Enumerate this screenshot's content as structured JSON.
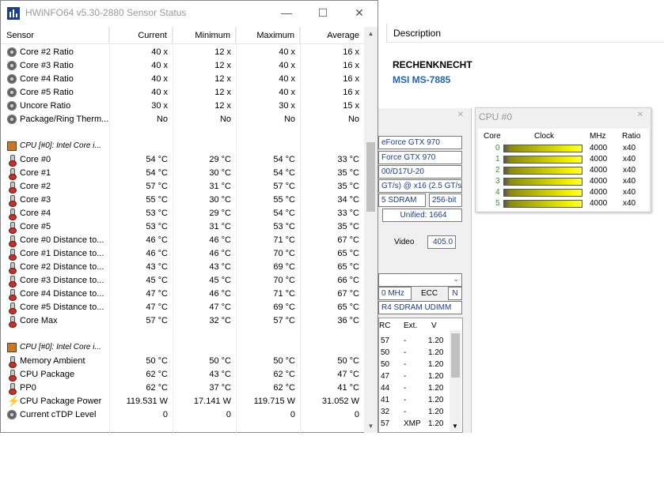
{
  "background_window": {
    "description_header": "Description",
    "machine_name": "RECHENKNECHT",
    "board_name": "MSI MS-7885",
    "summary": {
      "gpu_name_1": "eForce GTX 970",
      "gpu_name_2": "Force GTX 970",
      "gpu_id": "00/D17U-20",
      "gpu_bus": "GT/s) @ x16 (2.5 GT/s)",
      "gpu_mem_type": "5 SDRAM",
      "gpu_mem_width": "256-bit",
      "gpu_unified": "Unified: 1664",
      "video_label": "Video",
      "video_value": "405.0",
      "mem_clock": "0 MHz",
      "ecc_label": "ECC",
      "ecc_value": "N",
      "mem_type": "R4 SDRAM UDIMM",
      "mem_table_headers": [
        "RC",
        "Ext.",
        "V"
      ],
      "mem_table_rows": [
        [
          "57",
          "-",
          "1.20"
        ],
        [
          "50",
          "-",
          "1.20"
        ],
        [
          "50",
          "-",
          "1.20"
        ],
        [
          "47",
          "-",
          "1.20"
        ],
        [
          "44",
          "-",
          "1.20"
        ],
        [
          "41",
          "-",
          "1.20"
        ],
        [
          "32",
          "-",
          "1.20"
        ],
        [
          "57",
          "XMP",
          "1.20"
        ]
      ]
    }
  },
  "cpu_window": {
    "title": "CPU #0",
    "headers": [
      "Core",
      "Clock",
      "MHz",
      "Ratio"
    ],
    "cores": [
      {
        "index": "0",
        "mhz": "4000",
        "ratio": "x40",
        "level": 1.0
      },
      {
        "index": "1",
        "mhz": "4000",
        "ratio": "x40",
        "level": 1.0
      },
      {
        "index": "2",
        "mhz": "4000",
        "ratio": "x40",
        "level": 1.0
      },
      {
        "index": "3",
        "mhz": "4000",
        "ratio": "x40",
        "level": 1.0
      },
      {
        "index": "4",
        "mhz": "4000",
        "ratio": "x40",
        "level": 1.0
      },
      {
        "index": "5",
        "mhz": "4000",
        "ratio": "x40",
        "level": 1.0
      }
    ]
  },
  "sensor_window": {
    "title": "HWiNFO64 v5.30-2880 Sensor Status",
    "columns": [
      "Sensor",
      "Current",
      "Minimum",
      "Maximum",
      "Average"
    ],
    "rows": [
      {
        "icon": "gear-icon",
        "name": "Core #2 Ratio",
        "current": "40 x",
        "minimum": "12 x",
        "maximum": "40 x",
        "average": "16 x"
      },
      {
        "icon": "gear-icon",
        "name": "Core #3 Ratio",
        "current": "40 x",
        "minimum": "12 x",
        "maximum": "40 x",
        "average": "16 x"
      },
      {
        "icon": "gear-icon",
        "name": "Core #4 Ratio",
        "current": "40 x",
        "minimum": "12 x",
        "maximum": "40 x",
        "average": "16 x"
      },
      {
        "icon": "gear-icon",
        "name": "Core #5 Ratio",
        "current": "40 x",
        "minimum": "12 x",
        "maximum": "40 x",
        "average": "16 x"
      },
      {
        "icon": "gear-icon",
        "name": "Uncore Ratio",
        "current": "30 x",
        "minimum": "12 x",
        "maximum": "30 x",
        "average": "15 x"
      },
      {
        "icon": "gear-icon",
        "name": "Package/Ring Therm...",
        "current": "No",
        "minimum": "No",
        "maximum": "No",
        "average": "No"
      },
      {
        "icon": "",
        "name": "",
        "current": "",
        "minimum": "",
        "maximum": "",
        "average": ""
      },
      {
        "icon": "chip-icon",
        "group": true,
        "name": "CPU [#0]: Intel Core i...",
        "current": "",
        "minimum": "",
        "maximum": "",
        "average": ""
      },
      {
        "icon": "thermometer-icon",
        "name": "Core #0",
        "current": "54 °C",
        "minimum": "29 °C",
        "maximum": "54 °C",
        "average": "33 °C"
      },
      {
        "icon": "thermometer-icon",
        "name": "Core #1",
        "current": "54 °C",
        "minimum": "30 °C",
        "maximum": "54 °C",
        "average": "35 °C"
      },
      {
        "icon": "thermometer-icon",
        "name": "Core #2",
        "current": "57 °C",
        "minimum": "31 °C",
        "maximum": "57 °C",
        "average": "35 °C"
      },
      {
        "icon": "thermometer-icon",
        "name": "Core #3",
        "current": "55 °C",
        "minimum": "30 °C",
        "maximum": "55 °C",
        "average": "34 °C"
      },
      {
        "icon": "thermometer-icon",
        "name": "Core #4",
        "current": "53 °C",
        "minimum": "29 °C",
        "maximum": "54 °C",
        "average": "33 °C"
      },
      {
        "icon": "thermometer-icon",
        "name": "Core #5",
        "current": "53 °C",
        "minimum": "31 °C",
        "maximum": "53 °C",
        "average": "35 °C"
      },
      {
        "icon": "thermometer-icon",
        "name": "Core #0 Distance to...",
        "current": "46 °C",
        "minimum": "46 °C",
        "maximum": "71 °C",
        "average": "67 °C"
      },
      {
        "icon": "thermometer-icon",
        "name": "Core #1 Distance to...",
        "current": "46 °C",
        "minimum": "46 °C",
        "maximum": "70 °C",
        "average": "65 °C"
      },
      {
        "icon": "thermometer-icon",
        "name": "Core #2 Distance to...",
        "current": "43 °C",
        "minimum": "43 °C",
        "maximum": "69 °C",
        "average": "65 °C"
      },
      {
        "icon": "thermometer-icon",
        "name": "Core #3 Distance to...",
        "current": "45 °C",
        "minimum": "45 °C",
        "maximum": "70 °C",
        "average": "66 °C"
      },
      {
        "icon": "thermometer-icon",
        "name": "Core #4 Distance to...",
        "current": "47 °C",
        "minimum": "46 °C",
        "maximum": "71 °C",
        "average": "67 °C"
      },
      {
        "icon": "thermometer-icon",
        "name": "Core #5 Distance to...",
        "current": "47 °C",
        "minimum": "47 °C",
        "maximum": "69 °C",
        "average": "65 °C"
      },
      {
        "icon": "thermometer-icon",
        "name": "Core Max",
        "current": "57 °C",
        "minimum": "32 °C",
        "maximum": "57 °C",
        "average": "36 °C"
      },
      {
        "icon": "",
        "name": "",
        "current": "",
        "minimum": "",
        "maximum": "",
        "average": ""
      },
      {
        "icon": "chip-icon",
        "group": true,
        "name": "CPU [#0]: Intel Core i...",
        "current": "",
        "minimum": "",
        "maximum": "",
        "average": ""
      },
      {
        "icon": "thermometer-icon",
        "name": "Memory Ambient",
        "current": "50 °C",
        "minimum": "50 °C",
        "maximum": "50 °C",
        "average": "50 °C"
      },
      {
        "icon": "thermometer-icon",
        "name": "CPU Package",
        "current": "62 °C",
        "minimum": "43 °C",
        "maximum": "62 °C",
        "average": "47 °C"
      },
      {
        "icon": "thermometer-icon",
        "name": "PP0",
        "current": "62 °C",
        "minimum": "37 °C",
        "maximum": "62 °C",
        "average": "41 °C"
      },
      {
        "icon": "lightning-icon",
        "name": "CPU Package Power",
        "current": "119.531 W",
        "minimum": "17.141 W",
        "maximum": "119.715 W",
        "average": "31.052 W"
      },
      {
        "icon": "gear-icon",
        "name": "Current cTDP Level",
        "current": "0",
        "minimum": "0",
        "maximum": "0",
        "average": "0"
      }
    ]
  }
}
